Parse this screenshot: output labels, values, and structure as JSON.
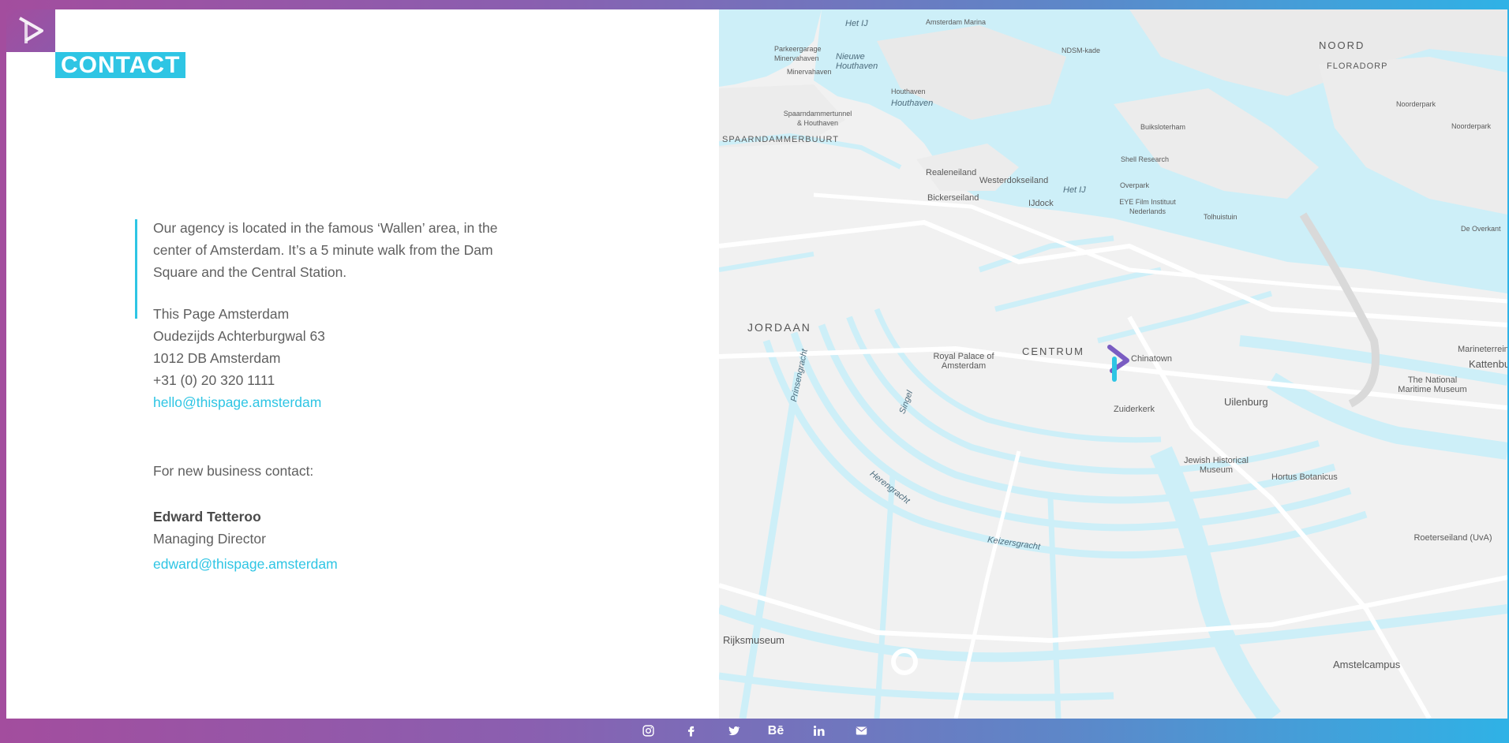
{
  "page": {
    "title": "CONTACT"
  },
  "intro": {
    "line1": "Our agency is located in the famous ‘Wallen’ area, in the",
    "line2": "center of Amsterdam. It’s a 5 minute walk from the Dam",
    "line3": "Square and the Central Station."
  },
  "address": {
    "company": "This Page Amsterdam",
    "street": "Oudezijds Achterburgwal 63",
    "city": "1012 DB Amsterdam",
    "phone": "+31 (0) 20 320 1111",
    "email": "hello@thispage.amsterdam"
  },
  "business": {
    "heading": "For new business contact:",
    "name": "Edward Tetteroo",
    "role": "Managing Director",
    "email": "edward@thispage.amsterdam"
  },
  "map": {
    "water_color": "#cdeff8",
    "land_color": "#f1f1f1",
    "labels": {
      "het_ij_top": "Het IJ",
      "amsterdam_marina": "Amsterdam Marina",
      "parkeergarage": "Parkeergarage Minervahaven",
      "nieuwe_houthaven": "Nieuwe Houthaven",
      "minervahaven": "Minervahaven",
      "houthaven1": "Houthaven",
      "houthaven2": "Houthaven",
      "ndsm": "NDSM-kade",
      "noord": "NOORD",
      "floradorp": "FLORADORP",
      "noorderpark1": "Noorderpark",
      "noorderpark2": "Noorderpark",
      "tunnel": "Spaarndammertunnel & Houthaven",
      "spaarndammerbuurt": "SPAARNDAMMERBUURT",
      "buiksloterham": "Buiksloterham",
      "shell": "Shell Research",
      "realeneiland": "Realeneiland",
      "westerdok": "Westerdokseiland",
      "het_ij_mid": "Het IJ",
      "overpark": "Overpark",
      "bickerseiland": "Bickerseiland",
      "ijdock": "IJdock",
      "eye": "EYE Film Instituut Nederlands",
      "tolhuistuin": "Tolhuistuin",
      "de_overkant": "De Overkant",
      "jordaan": "JORDAAN",
      "royal_palace": "Royal Palace of Amsterdam",
      "centrum": "CENTRUM",
      "chinatown": "Chinatown",
      "marineterrein": "Marineterrein",
      "kattenburg": "Kattenbu",
      "maritime": "The National Maritime Museum",
      "uilenburg": "Uilenburg",
      "zuiderkerk": "Zuiderkerk",
      "jewish": "Jewish Historical Museum",
      "hortus": "Hortus Botanicus",
      "keizersgracht": "Keizersgracht",
      "roeterseiland": "Roeterseiland (UvA)",
      "rijksmuseum": "Rijksmuseum",
      "amstelcampus": "Amstelcampus",
      "prinsengracht": "Prinsengracht",
      "singel": "Singel",
      "herengracht": "Herengracht"
    }
  },
  "social": {
    "instagram": "instagram-icon",
    "facebook": "facebook-icon",
    "twitter": "twitter-icon",
    "behance": "Bē",
    "linkedin": "linkedin-icon",
    "email": "envelope-icon"
  },
  "colors": {
    "accent": "#2ec5e4",
    "brand_purple": "#a34d9e",
    "text": "#5f5f5f"
  }
}
